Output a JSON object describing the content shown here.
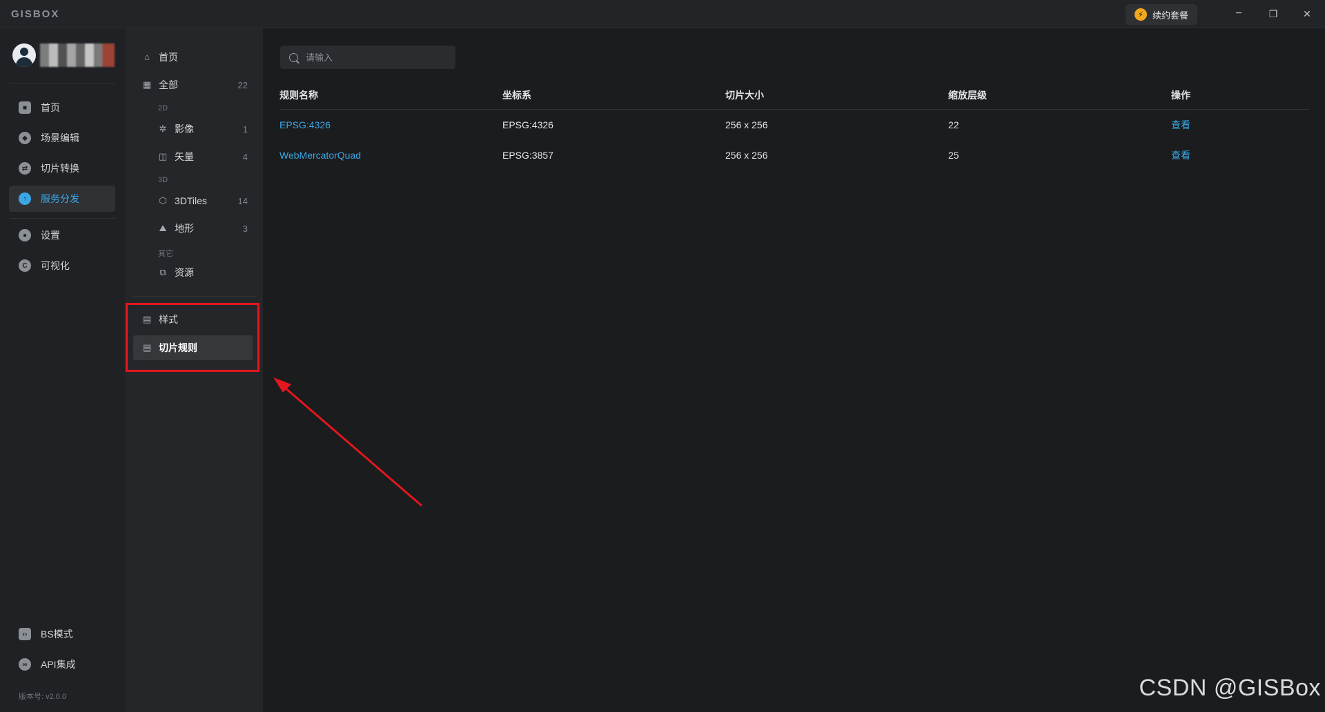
{
  "app": {
    "logo": "GISBOX"
  },
  "titlebar": {
    "renew_label": "续约套餐",
    "minimize": "−",
    "restore": "❐",
    "close": "✕"
  },
  "sidebar": {
    "items": [
      {
        "label": "首页",
        "icon": "home-icon"
      },
      {
        "label": "场景编辑",
        "icon": "scene-edit-icon"
      },
      {
        "label": "切片转换",
        "icon": "tile-convert-icon"
      },
      {
        "label": "服务分发",
        "icon": "service-publish-icon",
        "active": true
      },
      {
        "label": "设置",
        "icon": "settings-icon"
      },
      {
        "label": "可视化",
        "icon": "visualization-icon"
      }
    ],
    "bottom": [
      {
        "label": "BS模式",
        "icon": "bs-mode-icon"
      },
      {
        "label": "API集成",
        "icon": "api-integration-icon"
      }
    ],
    "version": "版本号: v2.0.0"
  },
  "subnav": {
    "home": "首页",
    "all": {
      "label": "全部",
      "count": "22"
    },
    "group_2d": "2D",
    "imagery": {
      "label": "影像",
      "count": "1"
    },
    "vector": {
      "label": "矢量",
      "count": "4"
    },
    "group_3d": "3D",
    "tiles3d": {
      "label": "3DTiles",
      "count": "14"
    },
    "terrain": {
      "label": "地形",
      "count": "3"
    },
    "group_other": "其它",
    "resources": {
      "label": "资源"
    },
    "style": "样式",
    "tile_rules": "切片规则"
  },
  "search": {
    "placeholder": "请输入"
  },
  "table": {
    "headers": [
      "规则名称",
      "坐标系",
      "切片大小",
      "缩放层级",
      "操作"
    ],
    "rows": [
      {
        "name": "EPSG:4326",
        "crs": "EPSG:4326",
        "tile_size": "256 x 256",
        "zoom": "22",
        "action": "查看"
      },
      {
        "name": "WebMercatorQuad",
        "crs": "EPSG:3857",
        "tile_size": "256 x 256",
        "zoom": "25",
        "action": "查看"
      }
    ]
  },
  "watermark": "CSDN @GISBox",
  "colors": {
    "accent": "#3aa7e4",
    "highlight": "#e5161e",
    "background": "#1b1c1e"
  }
}
